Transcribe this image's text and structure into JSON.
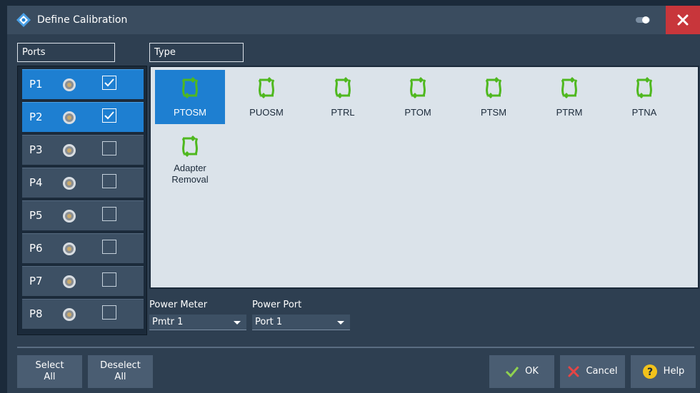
{
  "window": {
    "title": "Define Calibration",
    "logo_icon": "rs-logo-icon",
    "toggle_icon": "toggle-icon",
    "close_icon": "close-icon"
  },
  "ports": {
    "header": "Ports",
    "items": [
      {
        "label": "P1",
        "checked": true
      },
      {
        "label": "P2",
        "checked": true
      },
      {
        "label": "P3",
        "checked": false
      },
      {
        "label": "P4",
        "checked": false
      },
      {
        "label": "P5",
        "checked": false
      },
      {
        "label": "P6",
        "checked": false
      },
      {
        "label": "P7",
        "checked": false
      },
      {
        "label": "P8",
        "checked": false
      }
    ]
  },
  "types": {
    "header": "Type",
    "items": [
      {
        "name": "PTOSM",
        "selected": true
      },
      {
        "name": "PUOSM",
        "selected": false
      },
      {
        "name": "PTRL",
        "selected": false
      },
      {
        "name": "PTOM",
        "selected": false
      },
      {
        "name": "PTSM",
        "selected": false
      },
      {
        "name": "PTRM",
        "selected": false
      },
      {
        "name": "PTNA",
        "selected": false
      },
      {
        "name_line1": "Adapter",
        "name_line2": "Removal",
        "selected": false
      }
    ]
  },
  "power": {
    "meter_label": "Power Meter",
    "meter_value": "Pmtr 1",
    "port_label": "Power Port",
    "port_value": "Port 1"
  },
  "buttons": {
    "select_all_l1": "Select",
    "select_all_l2": "All",
    "deselect_all_l1": "Deselect",
    "deselect_all_l2": "All",
    "ok": "OK",
    "cancel": "Cancel",
    "help": "Help"
  },
  "colors": {
    "selected_blue": "#1e7fd1",
    "icon_green": "#4fb81f",
    "close_red": "#c8363b",
    "help_yellow": "#f2c21b",
    "panel_bg": "#dbe3ea"
  }
}
